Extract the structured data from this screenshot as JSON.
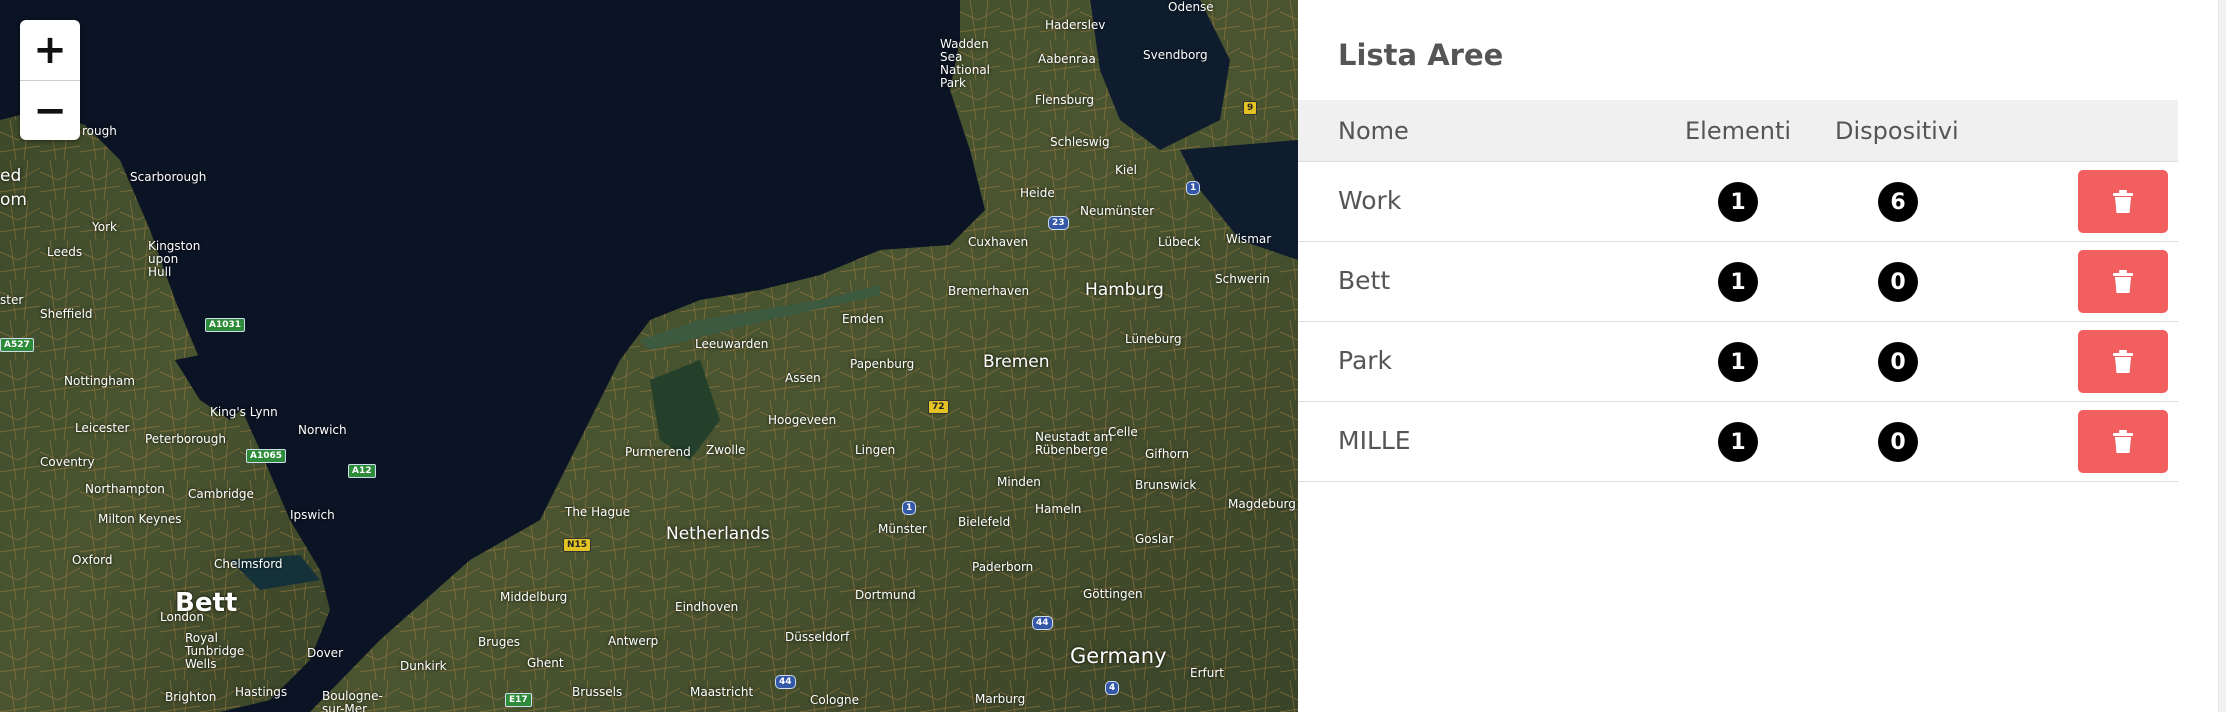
{
  "map": {
    "zoom_in_label": "+",
    "zoom_out_label": "−",
    "labels": {
      "scarborough": "Scarborough",
      "york": "York",
      "leeds": "Leeds",
      "kingston": "Kingston upon Hull",
      "sheffield": "Sheffield",
      "nottingham": "Nottingham",
      "kings_lynn": "King's Lynn",
      "norwich": "Norwich",
      "leicester": "Leicester",
      "peterborough": "Peterborough",
      "coventry": "Coventry",
      "northampton": "Northampton",
      "cambridge": "Cambridge",
      "ipswich": "Ipswich",
      "milton_keynes": "Milton Keynes",
      "oxford": "Oxford",
      "chelmsford": "Chelmsford",
      "london": "London",
      "bett": "Bett",
      "dover": "Dover",
      "brighton": "Brighton",
      "hastings": "Hastings",
      "tunbridge": "Royal Tunbridge Wells",
      "edge_ed": "ed",
      "edge_om": "om",
      "edge_rough": "rough",
      "edge_ster": "ster",
      "wadden": "Wadden Sea National Park",
      "haderslev": "Haderslev",
      "aabenraa": "Aabenraa",
      "svendborg": "Svendborg",
      "odense": "Odense",
      "flensburg": "Flensburg",
      "schleswig": "Schleswig",
      "heide": "Heide",
      "kiel": "Kiel",
      "neumunster": "Neumünster",
      "cuxhaven": "Cuxhaven",
      "lubeck": "Lübeck",
      "wismar": "Wismar",
      "schwerin": "Schwerin",
      "hamburg": "Hamburg",
      "bremerhaven": "Bremerhaven",
      "emden": "Emden",
      "leeuwarden": "Leeuwarden",
      "assen": "Assen",
      "papenburg": "Papenburg",
      "bremen": "Bremen",
      "luneburg": "Lüneburg",
      "hoogeveen": "Hoogeveen",
      "purmerend": "Purmerend",
      "zwolle": "Zwolle",
      "lingen": "Lingen",
      "neustadt": "Neustadt am Rübenberge",
      "celle": "Celle",
      "gifhorn": "Gifhorn",
      "the_hague": "The Hague",
      "netherlands": "Netherlands",
      "munster": "Münster",
      "bielefeld": "Bielefeld",
      "minden": "Minden",
      "hameln": "Hameln",
      "brunswick": "Brunswick",
      "magdeburg": "Magdeburg",
      "goslar": "Goslar",
      "middelburg": "Middelburg",
      "eindhoven": "Eindhoven",
      "dortmund": "Dortmund",
      "paderborn": "Paderborn",
      "gottingen": "Göttingen",
      "dunkirk": "Dunkirk",
      "bruges": "Bruges",
      "ghent": "Ghent",
      "antwerp": "Antwerp",
      "dusseldorf": "Düsseldorf",
      "germany": "Germany",
      "erfurt": "Erfurt",
      "boulogne": "Boulogne-sur-Mer",
      "brussels": "Brussels",
      "maastricht": "Maastricht",
      "cologne": "Cologne",
      "marburg": "Marburg"
    },
    "shields": {
      "a1031": "A1031",
      "a527": "A527",
      "a1065": "A1065",
      "a12": "A12",
      "e17": "E17",
      "n15": "N15",
      "r72": "72",
      "r9": "9",
      "r1a": "1",
      "r1b": "1",
      "r23": "23",
      "r44a": "44",
      "r44b": "44",
      "r4": "4"
    }
  },
  "panel": {
    "title": "Lista Aree",
    "columns": {
      "name": "Nome",
      "elements": "Elementi",
      "devices": "Dispositivi"
    },
    "rows": [
      {
        "name": "Work",
        "elements": "1",
        "devices": "6"
      },
      {
        "name": "Bett",
        "elements": "1",
        "devices": "0"
      },
      {
        "name": "Park",
        "elements": "1",
        "devices": "0"
      },
      {
        "name": "MILLE",
        "elements": "1",
        "devices": "0"
      }
    ],
    "delete_icon": "trash-icon"
  },
  "colors": {
    "delete_button": "#f25f5f",
    "badge": "#000000",
    "header_bg": "#f0f0f0",
    "text": "#555555",
    "sea": "#0b1424"
  }
}
